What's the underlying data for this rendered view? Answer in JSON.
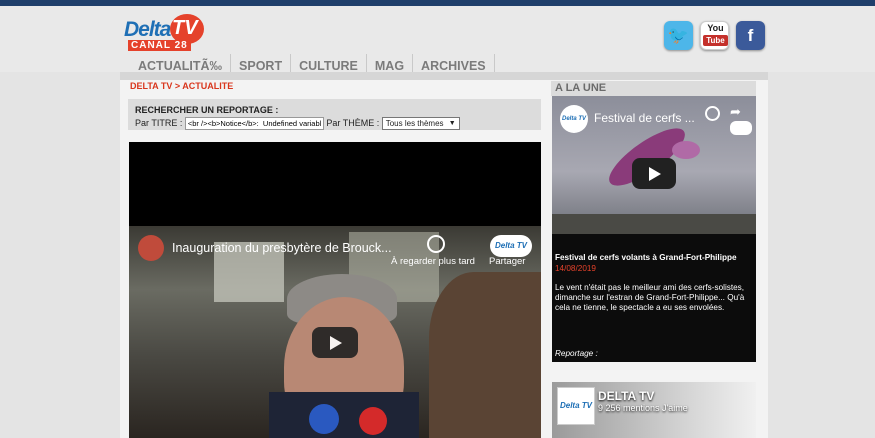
{
  "header": {
    "logo": {
      "delta": "Delta",
      "tv": "TV",
      "canal": "CANAL 28"
    },
    "social": [
      {
        "name": "twitter",
        "glyph": "🐦"
      },
      {
        "name": "youtube",
        "you": "You",
        "tube": "Tube"
      },
      {
        "name": "facebook",
        "glyph": "f"
      }
    ],
    "nav": [
      "ACTUALITÃ‰",
      "SPORT",
      "CULTURE",
      "MAG",
      "ARCHIVES"
    ]
  },
  "breadcrumb": "DELTA TV > ACTUALITE",
  "search": {
    "title": "RECHERCHER UN REPORTAGE :",
    "par_titre": "Par TITRE",
    "titre_value": "<br /><b>Notice</b>:  Undefined variable",
    "par_theme": "Par THÈME",
    "theme_value": "Tous les thèmes"
  },
  "main_video": {
    "title": "Inauguration du presbytère de Brouck...",
    "watch_later": "À regarder plus tard",
    "share": "Partager",
    "channel_logo": "Delta TV"
  },
  "sidebar": {
    "heading": "A LA UNE",
    "video": {
      "title": "Festival de cerfs ...",
      "channel_logo": "Delta TV"
    },
    "article": {
      "title": "Festival de cerfs volants à Grand-Fort-Philippe",
      "date": "14/08/2019",
      "text": "Le vent n'était pas le meilleur ami des cerfs-solistes, dimanche sur l'estran de Grand-Fort-Philippe... Qu'à cela ne tienne, le spectacle a eu ses envolées.",
      "reportage": "Reportage :"
    },
    "facebook": {
      "logo": "Delta TV",
      "name": "DELTA TV",
      "likes": "9 256 mentions J'aime"
    }
  }
}
